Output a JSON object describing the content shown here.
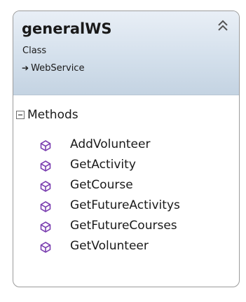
{
  "class": {
    "name": "generalWS",
    "kind": "Class",
    "base_type": "WebService",
    "collapse_icon": "double-chevron-up-icon",
    "inheritance_icon": "inheritance-arrow-icon"
  },
  "methods_section": {
    "title": "Methods",
    "toggle_icon": "collapse-minus-icon",
    "method_icon": "public-method-cube-icon",
    "method_icon_color": "#7b3fb0",
    "items": [
      {
        "label": "AddVolunteer"
      },
      {
        "label": "GetActivity"
      },
      {
        "label": "GetCourse"
      },
      {
        "label": "GetFutureActivitys"
      },
      {
        "label": "GetFutureCourses"
      },
      {
        "label": "GetVolunteer"
      }
    ]
  },
  "colors": {
    "header_gradient_top": "#e9eff6",
    "header_gradient_bottom": "#c4d3e2",
    "border": "#9b9b9b"
  }
}
